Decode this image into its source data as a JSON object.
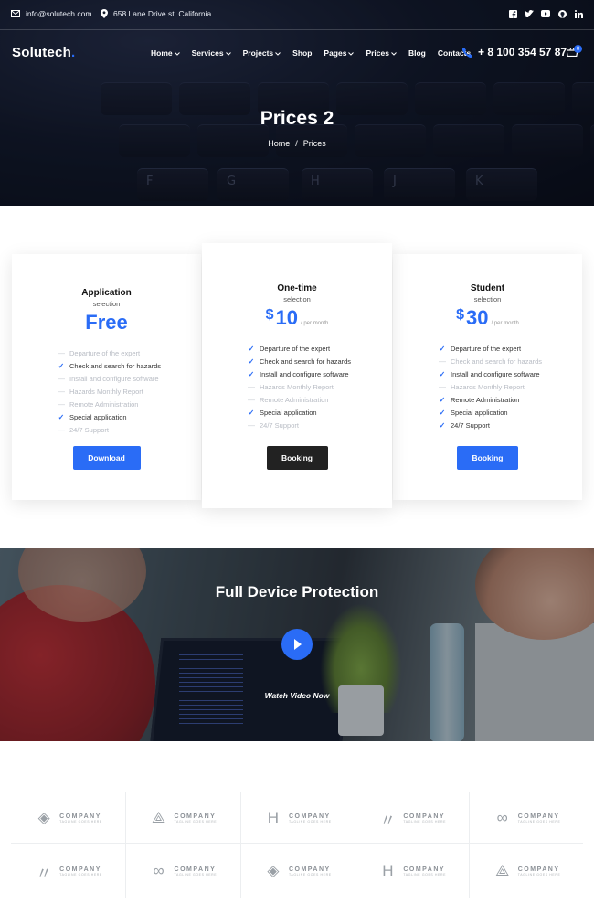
{
  "topbar": {
    "email": "info@solutech.com",
    "address": "658 Lane Drive st. California",
    "social_icons": [
      "facebook-icon",
      "twitter-icon",
      "youtube-icon",
      "github-icon",
      "linkedin-icon"
    ]
  },
  "nav": {
    "logo": "Solutech",
    "logo_dot": ".",
    "menu": [
      "Home",
      "Services",
      "Projects",
      "Shop",
      "Pages",
      "Prices",
      "Blog",
      "Contacts"
    ],
    "menu_dropdown": [
      true,
      true,
      true,
      false,
      true,
      true,
      false,
      false
    ],
    "phone": "+ 8 100 354 57 87",
    "cart_count": "0"
  },
  "hero": {
    "title": "Prices 2",
    "breadcrumb_home": "Home",
    "breadcrumb_sep": "/",
    "breadcrumb_current": "Prices",
    "keys": [
      "F",
      "G",
      "H",
      "J",
      "K"
    ]
  },
  "plans": [
    {
      "name": "Application",
      "subtitle": "selection",
      "price": "Free",
      "currency": "",
      "period": "",
      "features": [
        {
          "text": "Departure of the expert",
          "included": false
        },
        {
          "text": "Check and search for hazards",
          "included": true
        },
        {
          "text": "Install and configure software",
          "included": false
        },
        {
          "text": "Hazards Monthly Report",
          "included": false
        },
        {
          "text": "Remote Administration",
          "included": false
        },
        {
          "text": "Special application",
          "included": true
        },
        {
          "text": "24/7 Support",
          "included": false
        }
      ],
      "button": "Download",
      "button_color": "#2a6cf6"
    },
    {
      "name": "One-time",
      "subtitle": "selection",
      "price": "10",
      "currency": "$",
      "period": "/ per month",
      "features": [
        {
          "text": "Departure of the expert",
          "included": true
        },
        {
          "text": "Check and search for hazards",
          "included": true
        },
        {
          "text": "Install and configure software",
          "included": true
        },
        {
          "text": "Hazards Monthly Report",
          "included": false
        },
        {
          "text": "Remote Administration",
          "included": false
        },
        {
          "text": "Special application",
          "included": true
        },
        {
          "text": "24/7 Support",
          "included": false
        }
      ],
      "button": "Booking",
      "button_color": "#222222"
    },
    {
      "name": "Student",
      "subtitle": "selection",
      "price": "30",
      "currency": "$",
      "period": "/ per month",
      "features": [
        {
          "text": "Departure of the expert",
          "included": true
        },
        {
          "text": "Check and search for hazards",
          "included": false
        },
        {
          "text": "Install and configure software",
          "included": true
        },
        {
          "text": "Hazards Monthly Report",
          "included": false
        },
        {
          "text": "Remote Administration",
          "included": true
        },
        {
          "text": "Special application",
          "included": true
        },
        {
          "text": "24/7 Support",
          "included": true
        }
      ],
      "button": "Booking",
      "button_color": "#2a6cf6"
    }
  ],
  "video": {
    "title": "Full Device Protection",
    "cta": "Watch Video Now"
  },
  "partners": {
    "word": "COMPANY",
    "tagline": "TAGLINE GOES HERE",
    "glyphs": [
      "◈",
      "⟁",
      "H",
      "〃",
      "∞",
      "〃",
      "∞",
      "◈",
      "H",
      "⟁"
    ]
  },
  "colors": {
    "accent": "#2a6cf6",
    "dark_button": "#222222"
  }
}
